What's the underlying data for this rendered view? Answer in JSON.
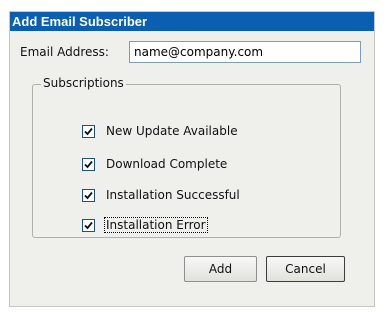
{
  "dialog": {
    "title": "Add Email Subscriber"
  },
  "email": {
    "label": "Email Address:",
    "value": "name@company.com"
  },
  "subscriptions": {
    "legend": "Subscriptions",
    "items": [
      {
        "label": "New Update Available",
        "checked": true
      },
      {
        "label": "Download Complete",
        "checked": true
      },
      {
        "label": "Installation Successful",
        "checked": true
      },
      {
        "label": "Installation Error",
        "checked": true
      }
    ]
  },
  "buttons": {
    "add": "Add",
    "cancel": "Cancel"
  }
}
